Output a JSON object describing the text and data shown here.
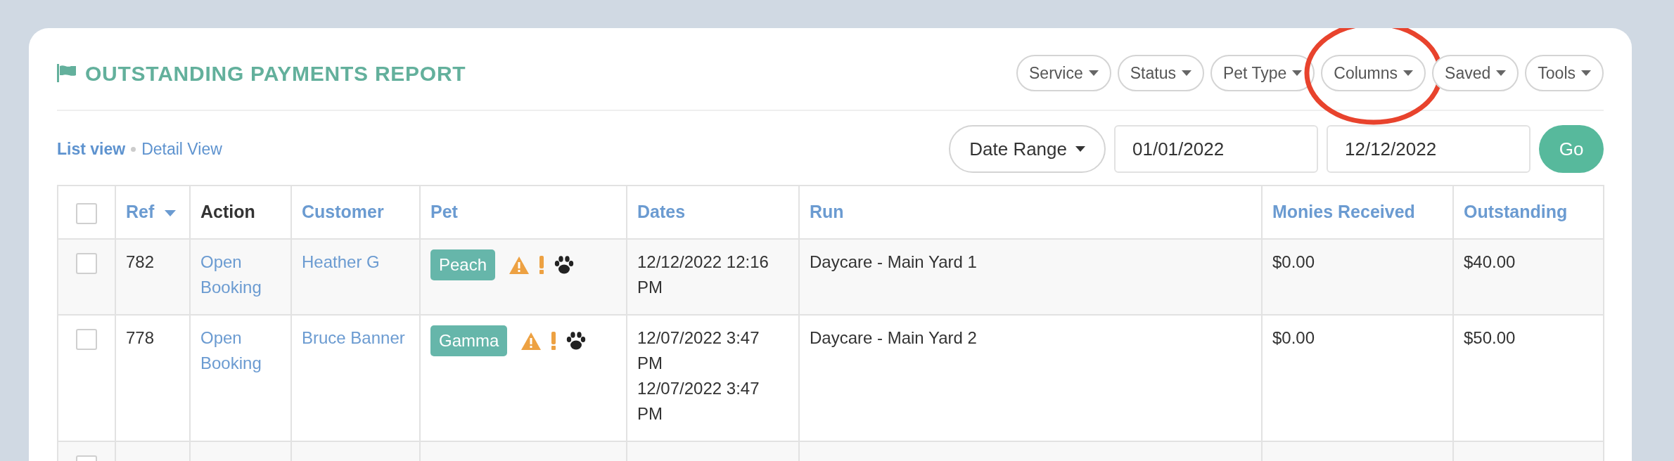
{
  "report": {
    "title": "OUTSTANDING PAYMENTS REPORT",
    "filters": [
      {
        "label": "Service",
        "highlighted": false
      },
      {
        "label": "Status",
        "highlighted": false
      },
      {
        "label": "Pet Type",
        "highlighted": false
      },
      {
        "label": "Columns",
        "highlighted": true
      },
      {
        "label": "Saved",
        "highlighted": false
      },
      {
        "label": "Tools",
        "highlighted": false
      }
    ],
    "views": [
      {
        "label": "List view",
        "selected": true
      },
      {
        "label": "Detail View",
        "selected": false
      }
    ],
    "date_range": {
      "label": "Date Range",
      "from": "01/01/2022",
      "to": "12/12/2022",
      "submit": "Go"
    },
    "table": {
      "select_all_checked": false,
      "columns": [
        {
          "label": "Ref",
          "link": true,
          "sorted": true
        },
        {
          "label": "Action",
          "link": false,
          "sorted": false
        },
        {
          "label": "Customer",
          "link": true,
          "sorted": false
        },
        {
          "label": "Pet",
          "link": true,
          "sorted": false
        },
        {
          "label": "Dates",
          "link": true,
          "sorted": false
        },
        {
          "label": "Run",
          "link": true,
          "sorted": false
        },
        {
          "label": "Monies Received",
          "link": true,
          "sorted": false
        },
        {
          "label": "Outstanding",
          "link": true,
          "sorted": false
        }
      ],
      "rows": [
        {
          "checked": false,
          "ref": "782",
          "action": "Open Booking",
          "customer": "Heather G",
          "pet": "Peach",
          "warning": true,
          "alert": true,
          "paw": true,
          "dates": [
            "12/12/2022 12:16 PM"
          ],
          "run": "Daycare - Main Yard 1",
          "received": "$0.00",
          "outstanding": "$40.00"
        },
        {
          "checked": false,
          "ref": "778",
          "action": "Open Booking",
          "customer": "Bruce Banner",
          "pet": "Gamma",
          "warning": true,
          "alert": true,
          "paw": true,
          "dates": [
            "12/07/2022 3:47 PM",
            "12/07/2022 3:47 PM"
          ],
          "run": "Daycare - Main Yard 2",
          "received": "$0.00",
          "outstanding": "$50.00"
        },
        {
          "checked": false
        }
      ]
    }
  }
}
